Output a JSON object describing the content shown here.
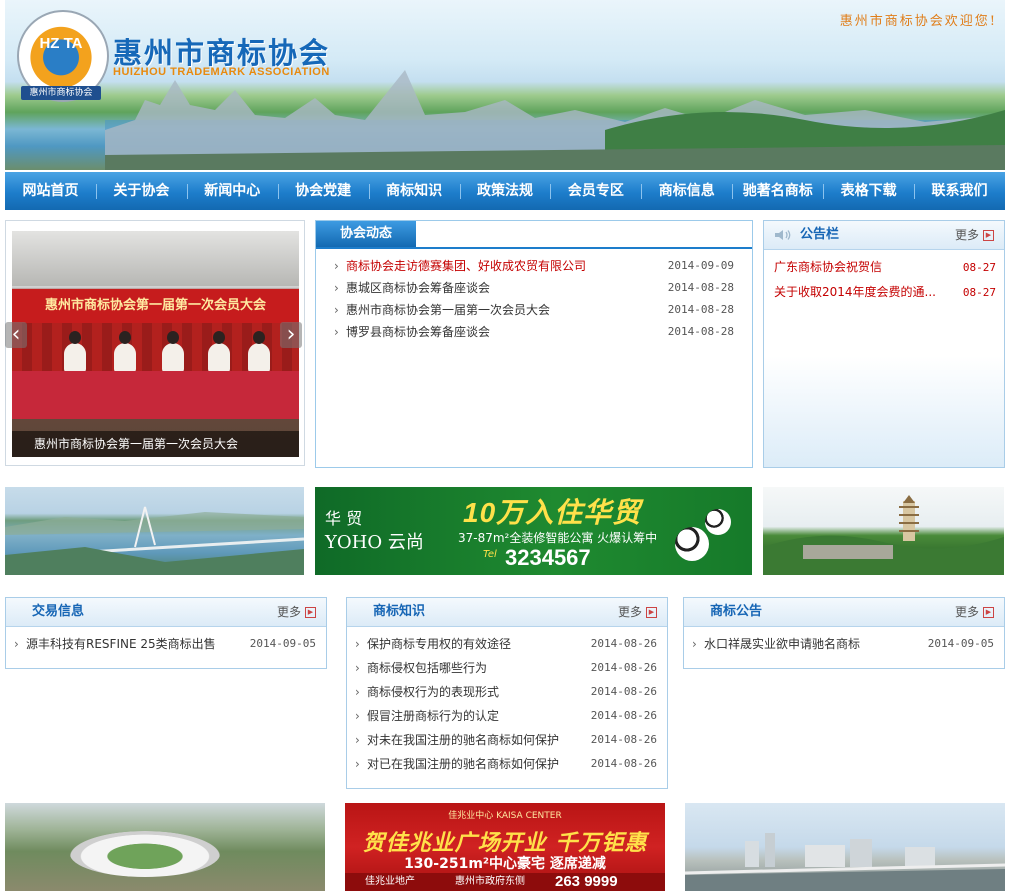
{
  "header": {
    "logo_letters": "HZ TA",
    "logo_caption": "惠州市商标协会",
    "site_name": "惠州市商标协会",
    "site_name_en": "HUIZHOU TRADEMARK ASSOCIATION",
    "welcome": "惠州市商标协会欢迎您!"
  },
  "nav": {
    "items": [
      "网站首页",
      "关于协会",
      "新闻中心",
      "协会党建",
      "商标知识",
      "政策法规",
      "会员专区",
      "商标信息",
      "驰著名商标",
      "表格下载",
      "联系我们"
    ]
  },
  "slideshow": {
    "banner_text": "惠州市商标协会第一届第一次会员大会",
    "caption": "惠州市商标协会第一届第一次会员大会",
    "prev_icon": "‹",
    "next_icon": "›"
  },
  "news": {
    "tab": "协会动态",
    "items": [
      {
        "title": "商标协会走访德赛集团、好收成农贸有限公司",
        "date": "2014-09-09"
      },
      {
        "title": "惠城区商标协会筹备座谈会",
        "date": "2014-08-28"
      },
      {
        "title": "惠州市商标协会第一届第一次会员大会",
        "date": "2014-08-28"
      },
      {
        "title": "博罗县商标协会筹备座谈会",
        "date": "2014-08-28"
      }
    ]
  },
  "notice": {
    "title": "公告栏",
    "more": "更多",
    "items": [
      {
        "title": "广东商标协会祝贺信",
        "date": "08-27"
      },
      {
        "title": "关于收取2014年度会费的通...",
        "date": "08-27"
      }
    ]
  },
  "ad1": {
    "brand": "华 贸",
    "brand2": "YOHO 云尚",
    "headline": "10万入住华贸",
    "sub": "37-87m²全装修智能公寓  火爆认筹中",
    "tel_label": "Tel",
    "tel": "3234567"
  },
  "trade": {
    "title": "交易信息",
    "more": "更多",
    "items": [
      {
        "title": "源丰科技有RESFINE 25类商标出售",
        "date": "2014-09-05"
      }
    ]
  },
  "knowledge": {
    "title": "商标知识",
    "more": "更多",
    "items": [
      {
        "title": "保护商标专用权的有效途径",
        "date": "2014-08-26"
      },
      {
        "title": "商标侵权包括哪些行为",
        "date": "2014-08-26"
      },
      {
        "title": "商标侵权行为的表现形式",
        "date": "2014-08-26"
      },
      {
        "title": "假冒注册商标行为的认定",
        "date": "2014-08-26"
      },
      {
        "title": "对未在我国注册的驰名商标如何保护",
        "date": "2014-08-26"
      },
      {
        "title": "对已在我国注册的驰名商标如何保护",
        "date": "2014-08-26"
      }
    ]
  },
  "announce": {
    "title": "商标公告",
    "more": "更多",
    "items": [
      {
        "title": "水口祥晟实业欲申请驰名商标",
        "date": "2014-09-05"
      }
    ]
  },
  "ad2": {
    "top": "佳兆业中心 KAISA CENTER",
    "headline": "贺佳兆业广场开业 千万钜惠",
    "sub": "130-251m²中心豪宅  逐席递减",
    "foot_a": "佳兆业地产",
    "foot_b": "惠州市政府东侧",
    "phone": "263 9999"
  }
}
